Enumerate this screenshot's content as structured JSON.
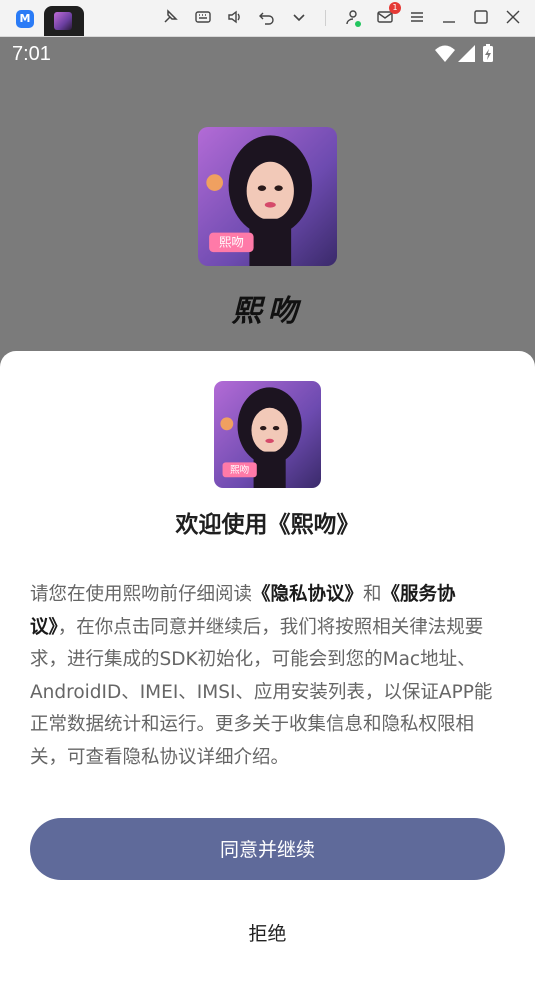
{
  "toolbar": {
    "logo": "M",
    "notification_count": "1",
    "icons": [
      "pin-icon",
      "keyboard-icon",
      "volume-icon",
      "undo-icon",
      "chevron-down-icon",
      "user-icon",
      "mail-icon",
      "menu-icon",
      "minimize-icon",
      "maximize-icon",
      "close-icon"
    ]
  },
  "status_bar": {
    "time": "7:01"
  },
  "splash": {
    "app_name": "熙吻",
    "icon_badge_text": "熙吻"
  },
  "dialog": {
    "title": "欢迎使用《熙吻》",
    "body_prefix": "请您在使用熙吻前仔细阅读",
    "privacy_link": "《隐私协议》",
    "and": "和",
    "service_link": "《服务协议》",
    "body_rest": "，在你点击同意并继续后，我们将按照相关律法规要求，进行集成的SDK初始化，可能会到您的Mac地址、AndroidID、IMEI、IMSI、应用安装列表，以保证APP能正常数据统计和运行。更多关于收集信息和隐私权限相关，可查看隐私协议详细介绍。",
    "agree_button": "同意并继续",
    "reject_button": "拒绝"
  },
  "colors": {
    "accent": "#5f6a9a",
    "overlay": "#7b7b7b"
  }
}
